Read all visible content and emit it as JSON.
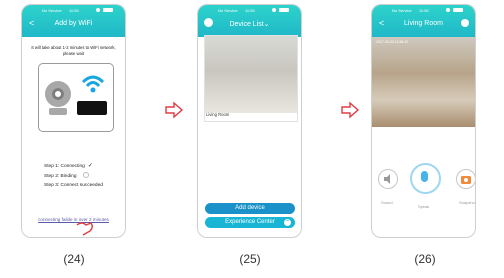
{
  "screens": [
    {
      "status": {
        "carrier": "No Service",
        "time": "11:50"
      },
      "title": "Add by WiFi",
      "message": "It will take about 1-2 minutes to WiFi network, please wait",
      "steps": [
        "Step 1: Connecting",
        "Step 2: Binding",
        "Step 3: Connect succeeded"
      ],
      "step1_mark": "✓",
      "fail_link": "connecting failde in over 2 minutes",
      "caption": "(24)"
    },
    {
      "status": {
        "carrier": "No Service",
        "time": "11:50"
      },
      "title": "Device List",
      "title_suffix": "⌄",
      "device_name": "Living Room",
      "add_button": "Add device",
      "experience_button": "Experience Center",
      "caption": "(25)"
    },
    {
      "status": {
        "carrier": "No Service",
        "time": "11:50"
      },
      "title": "Living Room",
      "timestamp": "2017-03-03 11:56:12",
      "controls": [
        "Sound",
        "Speak",
        "Snapshot"
      ],
      "caption": "(26)"
    }
  ],
  "colors": {
    "accent": "#1fb8c8",
    "button_blue": "#1a91c8",
    "arrow": "#e23b43"
  }
}
